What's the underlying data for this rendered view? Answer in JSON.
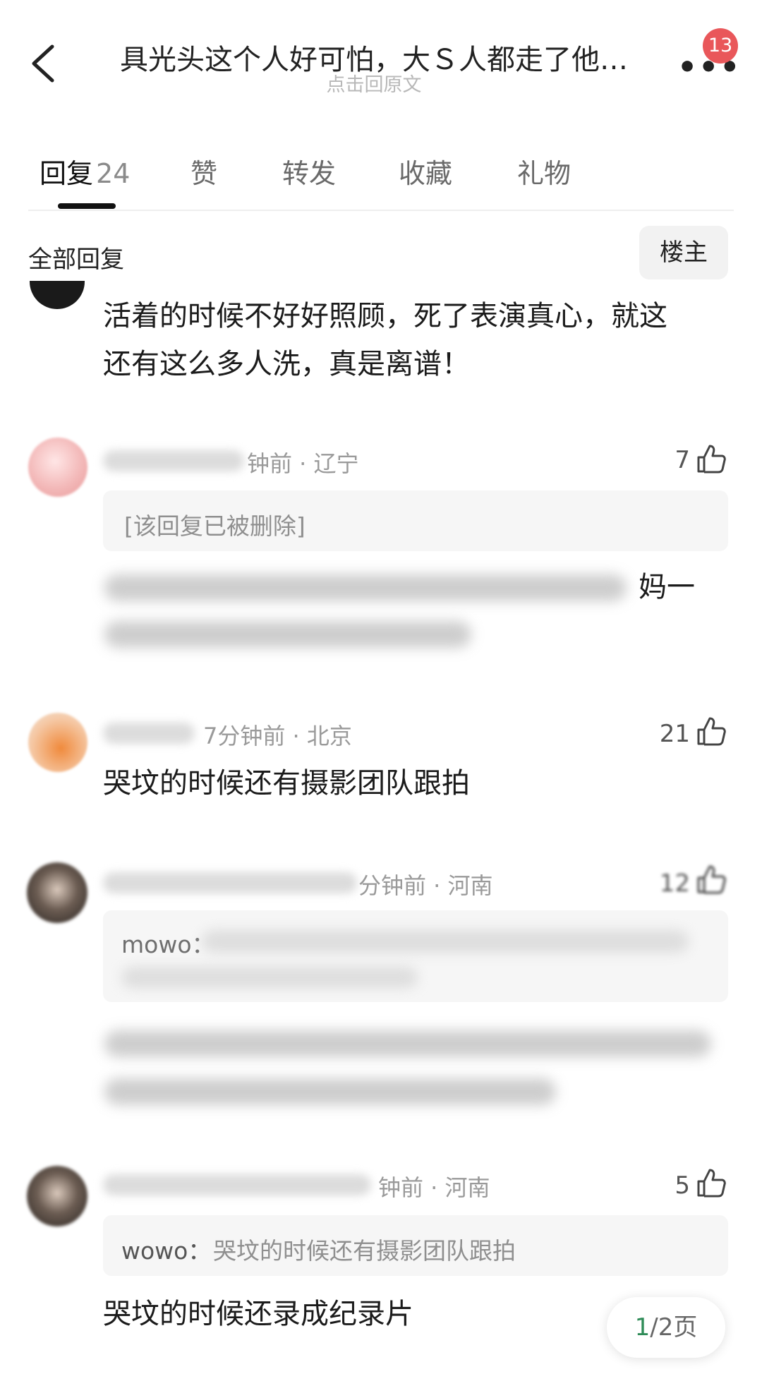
{
  "header": {
    "title": "具光头这个人好可怕，大Ｓ人都走了他…",
    "subtitle": "点击回原文",
    "badge_count": "13",
    "more_label": "•••"
  },
  "tabs": [
    {
      "label": "回复",
      "count": "24",
      "active": true
    },
    {
      "label": "赞"
    },
    {
      "label": "转发"
    },
    {
      "label": "收藏"
    },
    {
      "label": "礼物"
    }
  ],
  "section": {
    "title": "全部回复",
    "op_button": "楼主"
  },
  "comments": [
    {
      "lines": [
        "活着的时候不好好照顾，死了表演真心，就这",
        "还有这么多人洗，真是离谱！"
      ]
    },
    {
      "meta": "钟前 · 辽宁",
      "likes": "7",
      "quote": "[该回复已被删除]",
      "visible_fragment": "妈一"
    },
    {
      "meta": "7分钟前 · 北京",
      "likes": "21",
      "text": "哭坟的时候还有摄影团队跟拍"
    },
    {
      "meta": "分钟前 · 河南",
      "likes": "12",
      "quote_user": "mowo："
    },
    {
      "meta": "钟前 · 河南",
      "likes": "5",
      "quote_user": "wowo：",
      "quote_text": "哭坟的时候还有摄影团队跟拍",
      "text": "哭坟的时候还录成纪录片"
    }
  ],
  "pagination": {
    "current": "1",
    "total": "/2页"
  },
  "colors": {
    "badge": "#e9575a",
    "pager_current": "#2e8b57",
    "quote_bg": "#f6f6f6"
  }
}
